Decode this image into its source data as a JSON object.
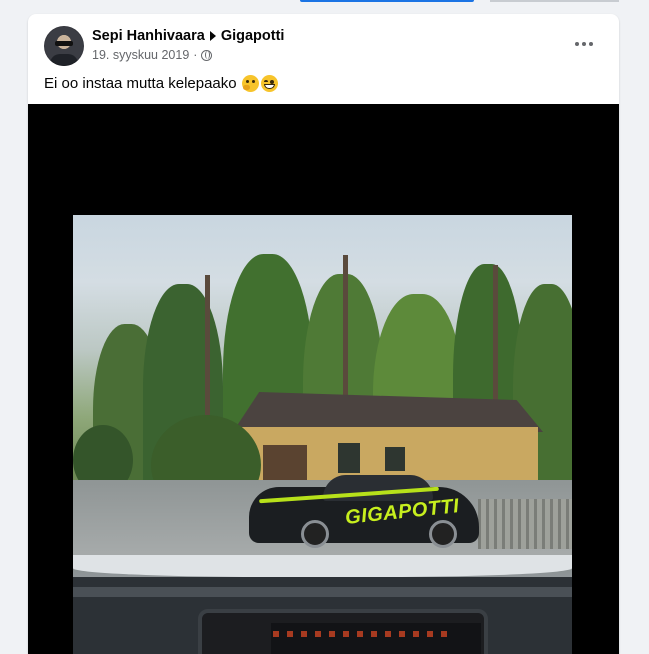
{
  "post": {
    "author": "Sepi Hanhivaara",
    "group": "Gigapotti",
    "date": "19. syyskuu 2019",
    "dot": "·",
    "privacy_icon": "globe-icon",
    "more_icon": "more-options-icon",
    "text": "Ei oo instaa mutta kelepaako",
    "emojis": [
      "thinking-face-emoji",
      "grinning-face-emoji"
    ],
    "photo": {
      "car_decal_text": "GIGAPOTTI"
    }
  },
  "colors": {
    "page_background": "#f0f2f5",
    "card_background": "#ffffff",
    "primary_text": "#050505",
    "secondary_text": "#65676b",
    "accent_tab": "#1b74e4",
    "decal_green": "#c7ef1e"
  }
}
